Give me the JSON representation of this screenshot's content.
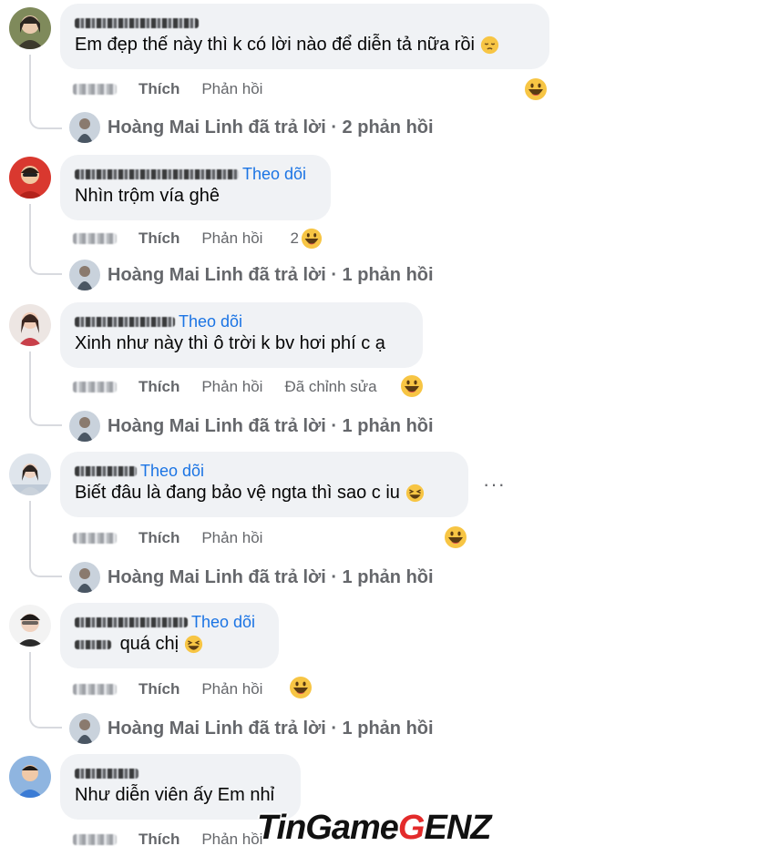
{
  "labels": {
    "like": "Thích",
    "reply": "Phản hồi",
    "edited": "Đã chỉnh sửa",
    "follow": "Theo dõi"
  },
  "comments": [
    {
      "name_visible": "Phạm Thùy Linh",
      "text": "Em đẹp thế này thì k có lời nào để diễn tả nữa rồi",
      "inline_emoji": "pensive-face-icon",
      "reaction": "grin-laugh-icon",
      "reply_summary": "Hoàng Mai Linh đã trả lời · 2 phản hồi"
    },
    {
      "name_visible": "Nguyễn ...",
      "text": "Nhìn trộm vía ghê",
      "reaction_count": "2",
      "reaction": "grin-laugh-icon",
      "reply_summary": "Hoàng Mai Linh đã trả lời · 1 phản hồi"
    },
    {
      "text": "Xinh như này thì ô trời k bv hơi phí c ạ",
      "reaction": "grin-laugh-icon",
      "reply_summary": "Hoàng Mai Linh đã trả lời · 1 phản hồi"
    },
    {
      "text": "Biết đâu là đang bảo vệ ngta thì sao c iu",
      "inline_emoji": "laughing-squint-icon",
      "reaction": "grin-laugh-icon",
      "reply_summary": "Hoàng Mai Linh đã trả lời · 1 phản hồi"
    },
    {
      "text": "quá chị",
      "inline_emoji": "laughing-squint-icon",
      "reaction": "grin-laugh-icon",
      "reply_summary": "Hoàng Mai Linh đã trả lời · 1 phản hồi"
    },
    {
      "text": "Như diễn viên ấy Em nhỉ"
    }
  ],
  "more_menu": "···",
  "watermark": {
    "part1": "TinGame",
    "part2": "G",
    "part3": "ENZ"
  },
  "colors": {
    "bubble": "#f0f2f5",
    "follow": "#1b74e4",
    "secondary_text": "#65676b",
    "watermark_accent": "#e32b2b"
  }
}
